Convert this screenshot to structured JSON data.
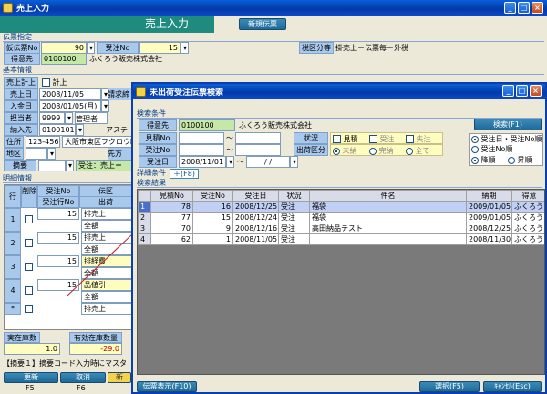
{
  "main": {
    "title": "売上入力",
    "header_title": "売上入力",
    "new_slip": "新規伝票",
    "sec_slip": "伝票指定",
    "karino_label": "仮伝票No",
    "karino_value": "90",
    "juchu_label": "受注No",
    "juchu_value": "15",
    "tokui_label": "得意先",
    "tokui_code": "0100100",
    "tokui_name": "ふくろう販売株式会社",
    "tax_label": "税区分等",
    "tax_value": "掛売上－伝票毎－外税",
    "sec_basic": "基本情報",
    "keijo_label": "売上計上",
    "keijo_check": "計上",
    "uriage_label": "売上日",
    "uriage_value": "2008/11/05",
    "seikyu_label": "請求締",
    "nyukin_label": "入金日",
    "nyukin_value": "2008/01/05(月)",
    "tanto_label": "担当者",
    "tanto_code": "9999",
    "tanto_name": "管理者",
    "nonyu_label": "納入先",
    "nonyu_code": "0100101",
    "nonyu_name": "アステ",
    "jusho_label": "住所",
    "zip": "123-456",
    "address": "大阪市東区フクロウ町",
    "chiku_label": "地区",
    "sakisoko_label": "先方",
    "tekiyo_label": "摘要",
    "tekiyo_value": "受注：売上＝",
    "sec_detail": "明細情報",
    "cols": [
      "行No",
      "削除",
      "伝区",
      "出荷"
    ],
    "cols2": [
      "受注No",
      "受注行No"
    ],
    "rows": [
      {
        "no": "1",
        "a": "15",
        "b": "排売上",
        "c": "全額"
      },
      {
        "no": "2",
        "a": "15",
        "b": "排売上",
        "c": "全額"
      },
      {
        "no": "3",
        "a": "15",
        "b": "排経費",
        "c": "全額"
      },
      {
        "no": "4",
        "a": "15",
        "b": "品値引",
        "c": "全額"
      },
      {
        "no": "*",
        "a": "",
        "b": "排売上",
        "c": ""
      }
    ],
    "stock_label1": "実在庫数量",
    "stock_label2": "有効在庫数量",
    "stock_val1": "1.0",
    "stock_val2": "-29.0",
    "msg": "【摘要１】摘要コード入力時にマスタ",
    "btn_update": "更新",
    "btn_cancel": "取消",
    "btn_misc": "新",
    "fkey_update": "F5",
    "fkey_cancel": "F6"
  },
  "dialog": {
    "title": "未出荷受注伝票検索",
    "sec_cond": "検索条件",
    "tokui_label": "得意先",
    "tokui_code": "0100100",
    "tokui_name": "ふくろう販売株式会社",
    "mitsumori_label": "見積No",
    "juchu_label": "受注No",
    "juchudate_label": "受注日",
    "date_from": "2008/11/01",
    "date_to": "/ /",
    "tilde": "～",
    "status_label": "状況",
    "status_opts": [
      "見積",
      "受注",
      "失注"
    ],
    "shukka_label": "出荷区分",
    "shukka_opts": [
      "未納",
      "完納",
      "全て"
    ],
    "search_btn": "検索(F1)",
    "sort_opts": [
      "受注日・受注No順",
      "受注No順"
    ],
    "order_opts": [
      "降順",
      "昇順"
    ],
    "detail_cond": "詳細条件",
    "detail_btn": "＋(F8)",
    "sec_result": "検索結果",
    "result_cols": [
      "見積No",
      "受注No",
      "受注日",
      "状況",
      "件名",
      "納期",
      "得意"
    ],
    "results": [
      {
        "no": "1",
        "mitsumori": "78",
        "juchu": "16",
        "date": "2008/12/25",
        "status": "受注",
        "subject": "福袋",
        "nouki": "2009/01/05",
        "tokui": "ふくろう"
      },
      {
        "no": "2",
        "mitsumori": "77",
        "juchu": "15",
        "date": "2008/12/24",
        "status": "受注",
        "subject": "福袋",
        "nouki": "2009/01/05",
        "tokui": "ふくろう"
      },
      {
        "no": "3",
        "mitsumori": "70",
        "juchu": "9",
        "date": "2008/12/16",
        "status": "受注",
        "subject": "高田納品テスト",
        "nouki": "2008/12/25",
        "tokui": "ふくろう"
      },
      {
        "no": "4",
        "mitsumori": "62",
        "juchu": "1",
        "date": "2008/11/05",
        "status": "受注",
        "subject": "",
        "nouki": "2008/11/30",
        "tokui": "ふくろう"
      }
    ],
    "btn_display": "伝票表示(F10)",
    "btn_select": "選択(F5)",
    "btn_cancel": "ｷｬﾝｾﾙ(Esc)"
  }
}
